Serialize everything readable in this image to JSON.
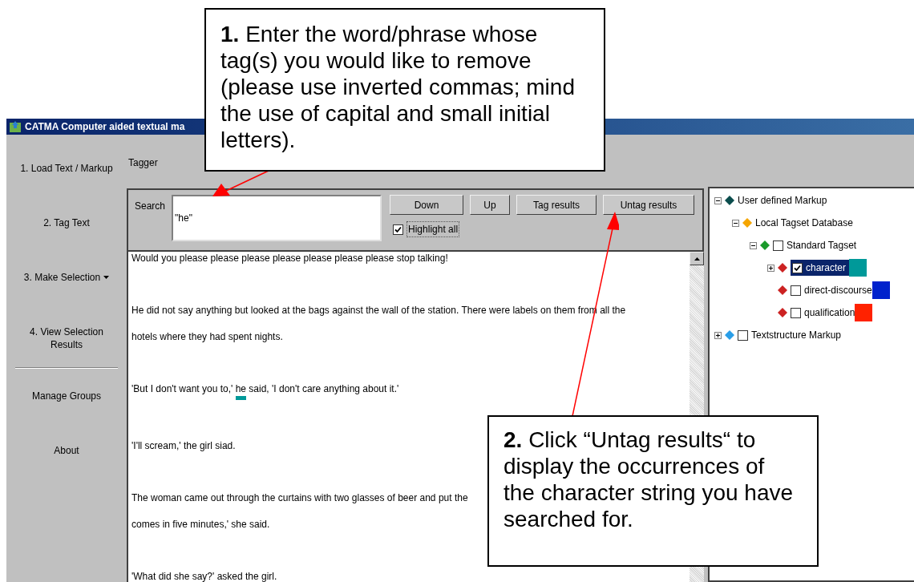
{
  "window": {
    "title": "CATMA Computer aided textual ma"
  },
  "sidebar": {
    "items": [
      {
        "label": "1. Load Text / Markup",
        "has_menu": false
      },
      {
        "label": "2. Tag Text",
        "has_menu": false
      },
      {
        "label": "3. Make Selection",
        "has_menu": true
      },
      {
        "label": "4. View Selection Results",
        "has_menu": false
      },
      {
        "label": "Manage Groups",
        "has_menu": false
      },
      {
        "label": "About",
        "has_menu": false
      }
    ]
  },
  "tagger": {
    "title": "Tagger"
  },
  "search": {
    "label": "Search",
    "value": "\"he\"",
    "highlight_all": {
      "label": "Highlight all",
      "checked": true
    },
    "buttons": [
      "Down",
      "Up",
      "Tag results",
      "Untag results"
    ]
  },
  "text": {
    "paragraphs": [
      {
        "lines": [
          [
            {
              "text": "Would you please please please please please please please stop talking!",
              "highlighted": false
            }
          ]
        ]
      },
      {
        "lines": [
          [
            {
              "text": "He did not say anything but looked at the bags against the wall of the station. There were labels on them from all the",
              "highlighted": false
            }
          ],
          [
            {
              "text": "hotels where they had spent nights.",
              "highlighted": false
            }
          ]
        ]
      },
      {
        "lines": [
          [
            {
              "text": "'But I don't want you to,' ",
              "highlighted": false
            },
            {
              "text": "he",
              "highlighted": true
            },
            {
              "text": " said, 'I don't care anything about it.'",
              "highlighted": false
            }
          ]
        ]
      },
      {
        "lines": [
          [
            {
              "text": "'I'll scream,' the girl siad.",
              "highlighted": false
            }
          ]
        ]
      },
      {
        "lines": [
          [
            {
              "text": "The woman came out through the curtains with two glasses of beer and put the",
              "highlighted": false
            }
          ],
          [
            {
              "text": "comes in five minutes,' she said.",
              "highlighted": false
            }
          ]
        ]
      },
      {
        "lines": [
          [
            {
              "text": "'What did she say?' asked the girl.",
              "highlighted": false
            }
          ]
        ]
      }
    ]
  },
  "tree": [
    {
      "label": "User defined Markup",
      "kind": "markup",
      "expanded": true,
      "children": [
        {
          "label": "Local Tagset Database",
          "kind": "database",
          "expanded": true,
          "children": [
            {
              "label": "Standard Tagset",
              "kind": "tagset",
              "expanded": true,
              "checked": false,
              "children": [
                {
                  "label": "character",
                  "kind": "tag",
                  "expanded": false,
                  "checked": true,
                  "selected": true,
                  "color": "#009999"
                },
                {
                  "label": "direct-discourse",
                  "kind": "tag",
                  "checked": false,
                  "selected": false,
                  "color": "#0022cc"
                },
                {
                  "label": "qualification",
                  "kind": "tag",
                  "checked": false,
                  "selected": false,
                  "color": "#ff2200"
                }
              ]
            }
          ]
        }
      ]
    },
    {
      "label": "Textstructure Markup",
      "kind": "structure",
      "expanded": false,
      "checked": false
    }
  ],
  "callouts": [
    {
      "text": "**1.** Enter the word/phrase whose tag(s) you would like to remove (please use inverted commas; mind the use of capital and small initial letters)."
    },
    {
      "text": "**2.** Click “Untag results“ to display the occurrences of the character string you have searched for."
    }
  ]
}
